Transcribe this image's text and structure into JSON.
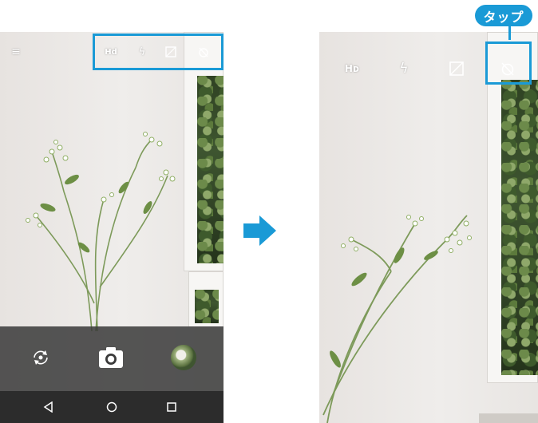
{
  "annotation": {
    "tap_label": "タップ",
    "accent_color": "#1a9ad6"
  },
  "left_screen": {
    "top_bar_icons": [
      "menu-icon",
      "hdr-off-icon",
      "flash-off-icon",
      "exposure-icon",
      "timer-off-icon"
    ],
    "controls": [
      "switch-camera-icon",
      "shutter-button",
      "gallery-thumbnail"
    ],
    "nav_bar": [
      "back-icon",
      "home-icon",
      "recents-icon"
    ]
  },
  "right_screen": {
    "top_bar_icons": [
      "hdr-off-icon",
      "flash-off-icon",
      "exposure-icon",
      "timer-off-icon"
    ],
    "highlighted_icon": "timer-off-icon"
  },
  "transition_arrow": "arrow-right-icon"
}
